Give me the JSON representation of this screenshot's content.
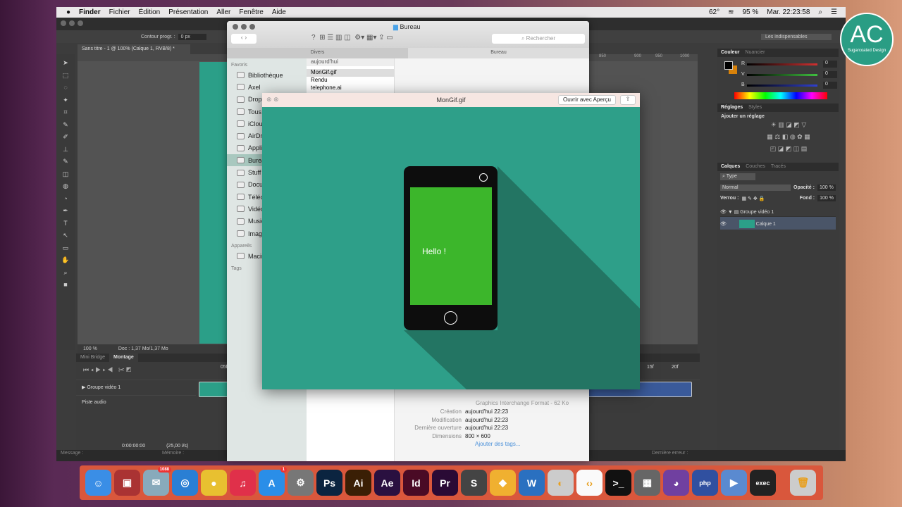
{
  "menubar": {
    "apple": "",
    "items": [
      "Finder",
      "Fichier",
      "Édition",
      "Présentation",
      "Aller",
      "Fenêtre",
      "Aide"
    ],
    "temperature": "62°",
    "battery": "95 %",
    "clock": "Mar. 22:23:58"
  },
  "photoshop": {
    "options": {
      "contour_label": "Contour progr. :",
      "contour_value": "0 px",
      "workspace": "Les indispensables"
    },
    "doc_tab": "Sans titre - 1 @ 100% (Calque 1, RVB/8) *",
    "ruler": [
      "850",
      "900",
      "950",
      "1000"
    ],
    "status": {
      "zoom": "100 %",
      "doc": "Doc : 1,37 Mo/1,37 Mo"
    },
    "timeline": {
      "tabs": [
        "Mini Bridge",
        "Montage"
      ],
      "tracks": [
        "Groupe vidéo 1",
        "Piste audio"
      ],
      "timecode": "0:00:00:00",
      "fps": "(25,00 i/s)",
      "marks": [
        "05f",
        "15f",
        "20f"
      ]
    },
    "color_panel": {
      "tabs": [
        "Couleur",
        "Nuancier"
      ],
      "channels": [
        {
          "label": "R",
          "value": "0",
          "color": "#d03030"
        },
        {
          "label": "V",
          "value": "0",
          "color": "#40c040"
        },
        {
          "label": "B",
          "value": "0",
          "color": "#3040d0"
        }
      ]
    },
    "adjust_panel": {
      "tabs": [
        "Réglages",
        "Styles"
      ],
      "title": "Ajouter un réglage"
    },
    "layers_panel": {
      "tabs": [
        "Calques",
        "Couches",
        "Tracés"
      ],
      "filter": "Type",
      "blend": "Normal",
      "opacity_label": "Opacité :",
      "opacity": "100 %",
      "lock_label": "Verrou :",
      "fill_label": "Fond :",
      "fill": "100 %",
      "layers": [
        "Groupe vidéo 1",
        "Calque 1"
      ]
    },
    "bottom": {
      "message": "Message :",
      "memory": "Mémoire :",
      "error": "Dernière erreur :"
    }
  },
  "finder": {
    "title": "Bureau",
    "search_placeholder": "Rechercher",
    "tabs": [
      "Divers",
      "Bureau"
    ],
    "favorites_header": "Favoris",
    "favorites": [
      "Bibliothèque",
      "Axel",
      "Dropbox",
      "Tous",
      "iCloud",
      "AirDrop",
      "Applications",
      "Bureau",
      "Stuff",
      "Documents",
      "Téléchargements",
      "Vidéos",
      "Musique",
      "Images"
    ],
    "devices_header": "Appareils",
    "devices": [
      "Macintosh"
    ],
    "tags_header": "Tags",
    "column_header": "aujourd'hui",
    "files": [
      "MonGif.gif",
      "Rendu",
      "telephone.ai"
    ],
    "info": {
      "kind": "Graphics Interchange Format - 62 Ko",
      "rows": [
        {
          "k": "Création",
          "v": "aujourd'hui 22:23"
        },
        {
          "k": "Modification",
          "v": "aujourd'hui 22:23"
        },
        {
          "k": "Dernière ouverture",
          "v": "aujourd'hui 22:23"
        },
        {
          "k": "Dimensions",
          "v": "800 × 600"
        }
      ],
      "add_tags": "Ajouter des tags..."
    }
  },
  "quicklook": {
    "title": "MonGif.gif",
    "open_with": "Ouvrir avec Aperçu",
    "screen_text": "Hello !",
    "colors": {
      "bg": "#2e9f89",
      "shadow": "#237563",
      "screen": "#3cb62b"
    }
  },
  "dock": [
    {
      "name": "finder",
      "label": "☺",
      "bg": "#3a8ee6"
    },
    {
      "name": "photo-booth",
      "label": "▣",
      "bg": "#a33"
    },
    {
      "name": "mail",
      "label": "✉",
      "bg": "#8ab",
      "badge": "1088"
    },
    {
      "name": "safari",
      "label": "◎",
      "bg": "#2a7fd4"
    },
    {
      "name": "chrome",
      "label": "●",
      "bg": "#e8c030"
    },
    {
      "name": "itunes",
      "label": "♫",
      "bg": "#e0304a"
    },
    {
      "name": "app-store",
      "label": "A",
      "bg": "#2a8ee8",
      "badge": "1"
    },
    {
      "name": "system-prefs",
      "label": "⚙",
      "bg": "#777"
    },
    {
      "name": "photoshop",
      "label": "Ps",
      "bg": "#0b2440"
    },
    {
      "name": "illustrator",
      "label": "Ai",
      "bg": "#3a1f05"
    },
    {
      "name": "after-effects",
      "label": "Ae",
      "bg": "#2a1040"
    },
    {
      "name": "indesign",
      "label": "Id",
      "bg": "#4a0a25"
    },
    {
      "name": "premiere",
      "label": "Pr",
      "bg": "#2a0a35"
    },
    {
      "name": "sublime",
      "label": "S",
      "bg": "#444"
    },
    {
      "name": "sketch",
      "label": "◆",
      "bg": "#f0b030"
    },
    {
      "name": "word",
      "label": "W",
      "bg": "#2a70c0"
    },
    {
      "name": "sequel",
      "label": "◐",
      "bg": "#ccc"
    },
    {
      "name": "coda",
      "label": "‹›",
      "bg": "#fafafa"
    },
    {
      "name": "terminal",
      "label": ">_",
      "bg": "#111"
    },
    {
      "name": "xampp",
      "label": "▦",
      "bg": "#666"
    },
    {
      "name": "github",
      "label": "◕",
      "bg": "#7040a0"
    },
    {
      "name": "php",
      "label": "php",
      "bg": "#3050a0"
    },
    {
      "name": "imovie",
      "label": "▶",
      "bg": "#5a8ad0"
    },
    {
      "name": "console",
      "label": "exec",
      "bg": "#222"
    },
    {
      "name": "trash",
      "label": "🗑",
      "bg": "#ccc"
    }
  ],
  "logo": {
    "initials": "AC",
    "tagline": "Sugarcoated Design"
  }
}
